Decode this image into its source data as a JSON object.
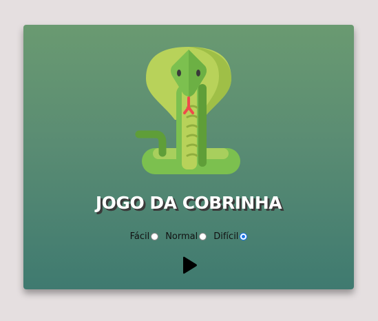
{
  "game": {
    "title": "JOGO DA COBRINHA",
    "logo_icon": "cobra-snake-icon",
    "difficulty": {
      "options": [
        {
          "label": "Fácil",
          "checked": false
        },
        {
          "label": "Normal",
          "checked": false
        },
        {
          "label": "Difícil",
          "checked": true
        }
      ],
      "selected": "Difícil"
    },
    "play_icon": "play-icon"
  },
  "colors": {
    "background": "#e5dfe0",
    "card_gradient_top": "#6a9a71",
    "card_gradient_bottom": "#3f7a70",
    "title_text": "#ffffff",
    "title_shadow": "#3a3a3a",
    "radio_selected": "#1a73e8"
  }
}
